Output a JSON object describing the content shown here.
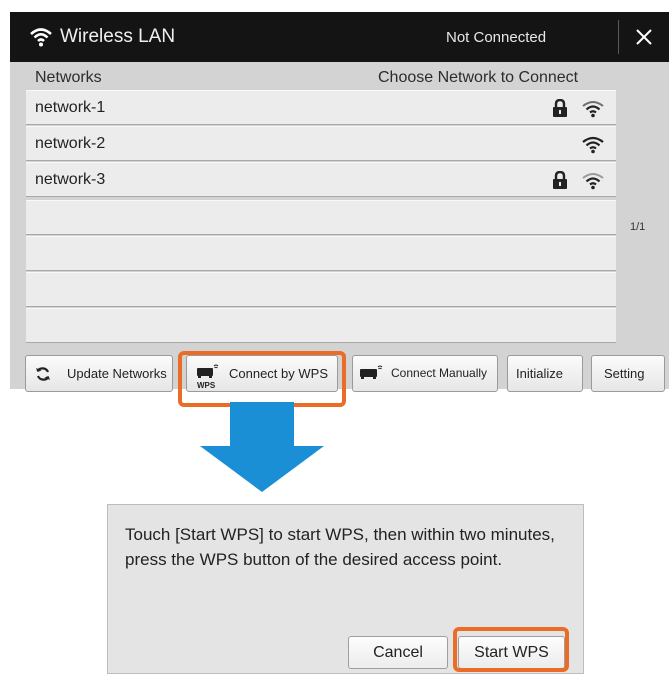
{
  "window": {
    "title": "Wireless LAN",
    "status": "Not Connected",
    "close_icon": "close-icon",
    "title_icon": "wifi-icon"
  },
  "list": {
    "header_left": "Networks",
    "header_right": "Choose Network to Connect",
    "networks": [
      {
        "name": "network-1",
        "secured": true,
        "signal": "wifi-signal-icon"
      },
      {
        "name": "network-2",
        "secured": false,
        "signal": "wifi-signal-icon"
      },
      {
        "name": "network-3",
        "secured": true,
        "signal": "wifi-signal-icon"
      }
    ],
    "empty_rows": 4,
    "page_indicator": "1/1"
  },
  "toolbar": {
    "update_label": "Update Networks",
    "wps_label": "Connect by WPS",
    "wps_icon_caption": "WPS",
    "manual_label": "Connect Manually",
    "initialize_label": "Initialize",
    "setting_label": "Setting"
  },
  "dialog": {
    "message": "Touch [Start WPS] to start WPS, then within two minutes, press the WPS button of the desired access point.",
    "cancel_label": "Cancel",
    "start_label": "Start WPS"
  },
  "colors": {
    "highlight": "#ea6c26",
    "arrow": "#1b8fd6",
    "titlebar": "#141414",
    "panel": "#d3d3d3"
  }
}
